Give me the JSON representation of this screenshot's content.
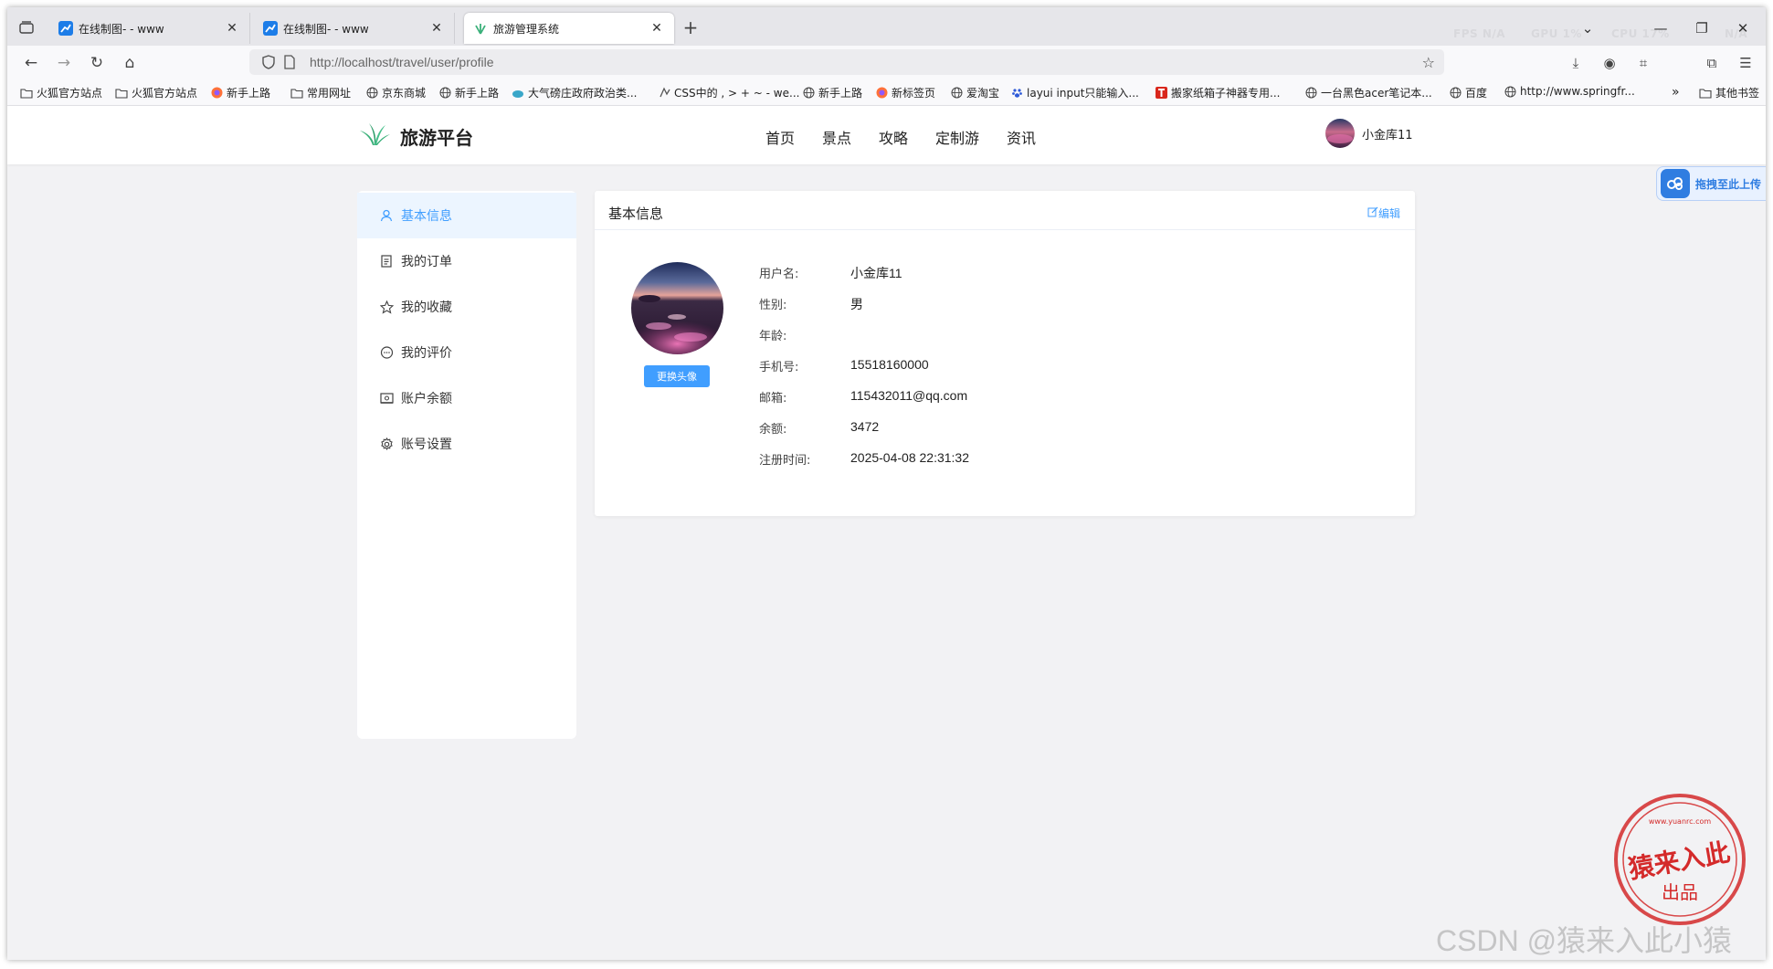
{
  "browser": {
    "tabs": [
      {
        "title": "在线制图- - www",
        "icon": "chart-favicon",
        "active": false
      },
      {
        "title": "在线制图- - www",
        "icon": "chart-favicon",
        "active": false
      },
      {
        "title": "旅游管理系统",
        "icon": "leaf-favicon",
        "active": true
      }
    ],
    "stats": {
      "fps": "FPS N/A",
      "gpu": "GPU 1%",
      "cpu": "CPU 17%",
      "mem": "N/A"
    },
    "url": "http://localhost/travel/user/profile",
    "bookmarks": [
      {
        "label": "火狐官方站点",
        "icon": "folder-icon"
      },
      {
        "label": "火狐官方站点",
        "icon": "folder-icon"
      },
      {
        "label": "新手上路",
        "icon": "firefox-icon"
      },
      {
        "label": "常用网址",
        "icon": "folder-icon"
      },
      {
        "label": "京东商城",
        "icon": "globe-icon"
      },
      {
        "label": "新手上路",
        "icon": "globe-icon"
      },
      {
        "label": "大气磅庄政府政治类...",
        "icon": "cloud-icon"
      },
      {
        "label": "CSS中的 , > + ~ - we...",
        "icon": "link-icon"
      },
      {
        "label": "新手上路",
        "icon": "globe-icon"
      },
      {
        "label": "新标签页",
        "icon": "firefox-icon"
      },
      {
        "label": "爱淘宝",
        "icon": "globe-icon"
      },
      {
        "label": "layui input只能输入...",
        "icon": "paw-icon"
      },
      {
        "label": "搬家纸箱子神器专用...",
        "icon": "t-icon"
      },
      {
        "label": "一台黑色acer笔记本...",
        "icon": "globe-icon"
      },
      {
        "label": "百度",
        "icon": "globe-icon"
      },
      {
        "label": "http://www.springfr...",
        "icon": "globe-icon"
      },
      {
        "label": "其他书签",
        "icon": "folder-icon"
      }
    ]
  },
  "site": {
    "logo_text": "旅游平台",
    "nav": [
      "首页",
      "景点",
      "攻略",
      "定制游",
      "资讯"
    ],
    "user_name": "小金库11",
    "baidu_float": "拖拽至此上传"
  },
  "sidebar": {
    "items": [
      {
        "label": "基本信息",
        "icon": "user-icon",
        "active": true
      },
      {
        "label": "我的订单",
        "icon": "document-icon",
        "active": false
      },
      {
        "label": "我的收藏",
        "icon": "star-icon",
        "active": false
      },
      {
        "label": "我的评价",
        "icon": "comment-icon",
        "active": false
      },
      {
        "label": "账户余额",
        "icon": "wallet-icon",
        "active": false
      },
      {
        "label": "账号设置",
        "icon": "gear-icon",
        "active": false
      }
    ]
  },
  "profile": {
    "card_title": "基本信息",
    "edit_label": "编辑",
    "change_avatar_label": "更换头像",
    "fields": [
      {
        "label": "用户名:",
        "value": "小金库11"
      },
      {
        "label": "性别:",
        "value": "男"
      },
      {
        "label": "年龄:",
        "value": ""
      },
      {
        "label": "手机号:",
        "value": "15518160000"
      },
      {
        "label": "邮箱:",
        "value": "115432011@qq.com"
      },
      {
        "label": "余额:",
        "value": "3472"
      },
      {
        "label": "注册时间:",
        "value": "2025-04-08 22:31:32"
      }
    ]
  },
  "watermark": {
    "csdn": "CSDN @猿来入此小猿",
    "stamp_main": "猿来入此",
    "stamp_sub": "出品",
    "stamp_url": "www.yuanrc.com"
  },
  "colors": {
    "accent": "#409eff",
    "active_bg": "#ecf5ff",
    "page_bg": "#f2f2f4",
    "stamp": "#d42a2a"
  }
}
